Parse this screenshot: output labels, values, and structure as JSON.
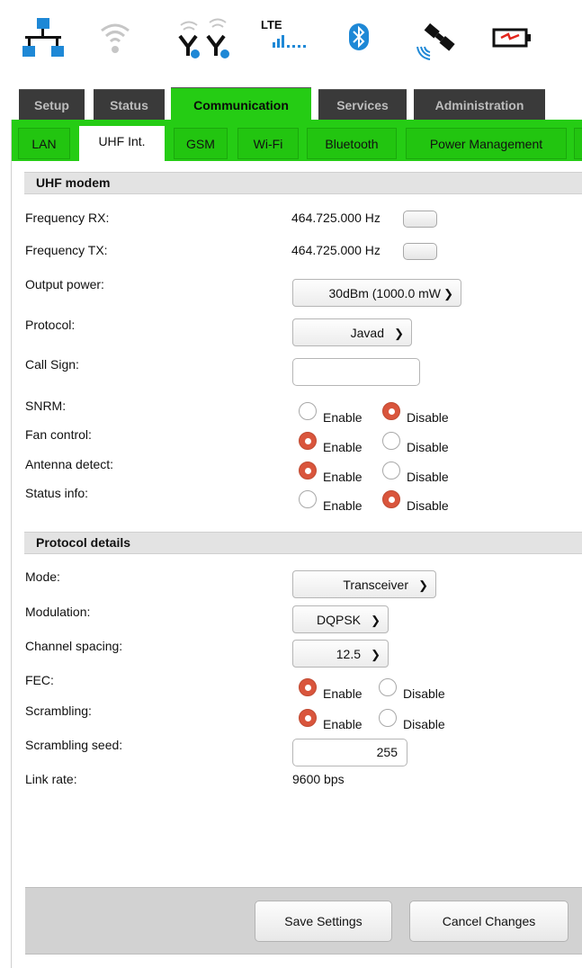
{
  "icons": {
    "network": "network-icon",
    "wifi": "wifi-icon",
    "antennas": "antenna-icon",
    "lte": {
      "label": "LTE",
      "icon": "signal-bars-icon"
    },
    "bluetooth": "bluetooth-icon",
    "satellite": "satellite-icon",
    "battery": "battery-icon"
  },
  "main_tabs": [
    {
      "label": "Setup"
    },
    {
      "label": "Status"
    },
    {
      "label": "Communication"
    },
    {
      "label": "Services"
    },
    {
      "label": "Administration"
    }
  ],
  "sub_tabs": [
    {
      "label": "LAN"
    },
    {
      "label": "UHF Int."
    },
    {
      "label": "GSM"
    },
    {
      "label": "Wi-Fi"
    },
    {
      "label": "Bluetooth"
    },
    {
      "label": "Power Management"
    }
  ],
  "uhf_modem": {
    "title": "UHF modem",
    "frequency_rx": {
      "label": "Frequency RX:",
      "value": "464.725.000 Hz"
    },
    "frequency_tx": {
      "label": "Frequency TX:",
      "value": "464.725.000 Hz"
    },
    "output_power": {
      "label": "Output power:",
      "value": "30dBm (1000.0 mW"
    },
    "protocol": {
      "label": "Protocol:",
      "value": "Javad"
    },
    "call_sign": {
      "label": "Call Sign:",
      "value": ""
    },
    "snrm": {
      "label": "SNRM:",
      "selected": "Disable"
    },
    "fan_control": {
      "label": "Fan control:",
      "selected": "Enable"
    },
    "antenna_detect": {
      "label": "Antenna detect:",
      "selected": "Enable"
    },
    "status_info": {
      "label": "Status info:",
      "selected": "Disable"
    }
  },
  "protocol_details": {
    "title": "Protocol details",
    "mode": {
      "label": "Mode:",
      "value": "Transceiver"
    },
    "modulation": {
      "label": "Modulation:",
      "value": "DQPSK"
    },
    "channel_spacing": {
      "label": "Channel spacing:",
      "value": "12.5"
    },
    "fec": {
      "label": "FEC:",
      "selected": "Enable"
    },
    "scrambling": {
      "label": "Scrambling:",
      "selected": "Enable"
    },
    "scrambling_seed": {
      "label": "Scrambling seed:",
      "value": "255"
    },
    "link_rate": {
      "label": "Link rate:",
      "value": "9600 bps"
    }
  },
  "radio_options": {
    "enable": "Enable",
    "disable": "Disable"
  },
  "footer": {
    "save_label": "Save Settings",
    "cancel_label": "Cancel Changes"
  },
  "colors": {
    "accent_green": "#25cc14",
    "dark_tab": "#3a3a3a",
    "radio_selected": "#d9553c",
    "network_blue": "#1e88d6"
  }
}
